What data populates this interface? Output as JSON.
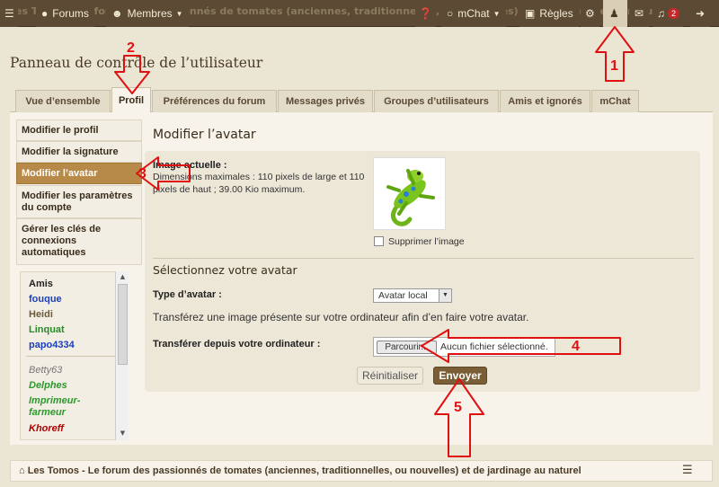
{
  "topbar": {
    "ghost_text": "Les Tomos - Le forum des passionnés de tomates (anciennes, traditionnelles, ou nouvelles) et de jardinage au naturel",
    "forums": "Forums",
    "members": "Membres",
    "mchat": "mChat",
    "rules": "Règles",
    "notifications_count": "2"
  },
  "page_title": "Panneau de contrôle de l’utilisateur",
  "tabs": [
    {
      "label": "Vue d’ensemble"
    },
    {
      "label": "Profil"
    },
    {
      "label": "Préférences du forum"
    },
    {
      "label": "Messages privés"
    },
    {
      "label": "Groupes d’utilisateurs"
    },
    {
      "label": "Amis et ignorés"
    },
    {
      "label": "mChat"
    }
  ],
  "sidebar": {
    "items": [
      {
        "label": "Modifier le profil"
      },
      {
        "label": "Modifier la signature"
      },
      {
        "label": "Modifier l’avatar"
      },
      {
        "label": "Modifier les paramètres du compte"
      },
      {
        "label": "Gérer les clés de connexions automatiques"
      }
    ],
    "friends_header": "Amis",
    "friends": [
      {
        "name": "fouque",
        "color": "#1a3fbf"
      },
      {
        "name": "Heidi",
        "color": "#6b5a3a"
      },
      {
        "name": "Linquat",
        "color": "#2a8a2a"
      },
      {
        "name": "papo4334",
        "color": "#1a3fbf"
      },
      {
        "name": "Betty63",
        "color": "#777777"
      },
      {
        "name": "Delphes",
        "color": "#2a9a2a"
      },
      {
        "name": "Imprimeur-farmeur",
        "color": "#2a9a2a"
      },
      {
        "name": "Khoreff",
        "color": "#b00000"
      }
    ]
  },
  "main": {
    "title": "Modifier l’avatar",
    "current_image_label": "Image actuelle :",
    "dimensions_text": "Dimensions maximales : 110 pixels de large et 110 pixels de haut ; 39.00 Kio maximum.",
    "delete_image": "Supprimer l’image",
    "select_title": "Sélectionnez votre avatar",
    "avatar_type_label": "Type d’avatar :",
    "avatar_type_value": "Avatar local",
    "upload_desc": "Transférez une image présente sur votre ordinateur afin d’en faire votre avatar.",
    "upload_label": "Transférer depuis votre ordinateur :",
    "browse_label": "Parcourir...",
    "no_file": "Aucun fichier sélectionné.",
    "reset_label": "Réinitialiser",
    "submit_label": "Envoyer"
  },
  "footer": {
    "text": "Les Tomos - Le forum des passionnés de tomates (anciennes, traditionnelles, ou nouvelles) et de jardinage au naturel"
  },
  "annotations": [
    "1",
    "2",
    "3",
    "4",
    "5"
  ],
  "colors": {
    "accent_brown": "#7a5e36",
    "annotation_red": "#e01010",
    "active_sidebar": "#b88a4a"
  }
}
